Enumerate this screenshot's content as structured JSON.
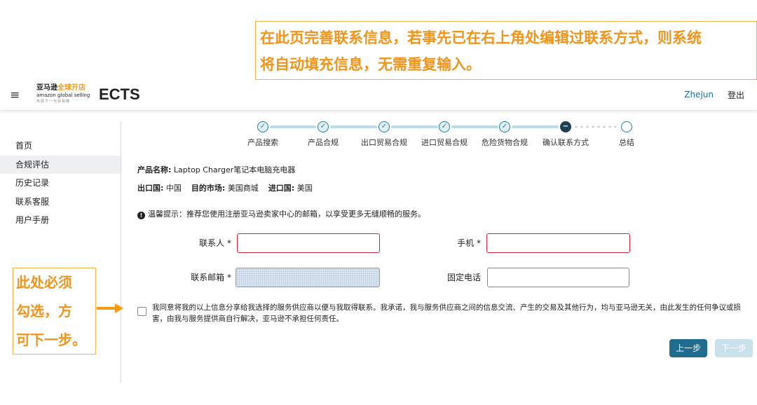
{
  "annotations": {
    "top": [
      "在此页完善联系信息，若事先已在右上角处编辑过联系方式，则系统",
      "将自动填充信息，无需重复输入。"
    ],
    "left": [
      "此处必须",
      "勾选，方",
      "可下一步。"
    ]
  },
  "header": {
    "menu_icon": "≡",
    "logo": {
      "brand_cn": "亚马逊",
      "brand_cn_accent": "全球开店",
      "brand_en": "amazon global selling",
      "slogan": "布局下一代贸易链"
    },
    "app_title": "ECTS",
    "user": "Zhejun",
    "logout": "登出"
  },
  "sidebar": {
    "items": [
      {
        "label": "首页",
        "active": false
      },
      {
        "label": "合规评估",
        "active": true
      },
      {
        "label": "历史记录",
        "active": false
      },
      {
        "label": "联系客服",
        "active": false
      },
      {
        "label": "用户手册",
        "active": false
      }
    ]
  },
  "stepper": {
    "steps": [
      {
        "label": "产品搜索",
        "status": "done"
      },
      {
        "label": "产品合规",
        "status": "done"
      },
      {
        "label": "出口贸易合规",
        "status": "done"
      },
      {
        "label": "进口贸易合规",
        "status": "done"
      },
      {
        "label": "危险货物合规",
        "status": "done"
      },
      {
        "label": "确认联系方式",
        "status": "current"
      },
      {
        "label": "总结",
        "status": "pending"
      }
    ],
    "check_glyph": "✓",
    "current_glyph": "−"
  },
  "product": {
    "name_label": "产品名称:",
    "name_value": "Laptop Charger笔记本电脑充电器",
    "export_label": "出口国:",
    "export_value": "中国",
    "market_label": "目的市场:",
    "market_value": "美国商城",
    "import_label": "进口国:",
    "import_value": "美国"
  },
  "tip": {
    "icon": "!",
    "text": "温馨提示：推荐您使用注册亚马逊卖家中心的邮箱，以享受更多无缝顺畅的服务。"
  },
  "form": {
    "contact_label": "联系人 *",
    "contact_value": "",
    "mobile_label": "手机 *",
    "mobile_value": "",
    "email_label": "联系邮箱 *",
    "email_value": "",
    "phone_label": "固定电话",
    "phone_value": ""
  },
  "agreement": {
    "text": "我同意将我的以上信息分享给我选择的服务供应商以便与我取得联系。我承诺，我与服务供应商之间的信息交流、产生的交易及其他行为，均与亚马逊无关，由此发生的任何争议或损害，由我与服务提供商自行解决，亚马逊不承担任何责任。",
    "checked": false
  },
  "buttons": {
    "prev": "上一步",
    "next": "下一步"
  },
  "colors": {
    "accent": "#1f6c8f",
    "annotation": "#f0941c",
    "error_border": "#c8283a",
    "disabled_button": "#c9e1ec"
  }
}
